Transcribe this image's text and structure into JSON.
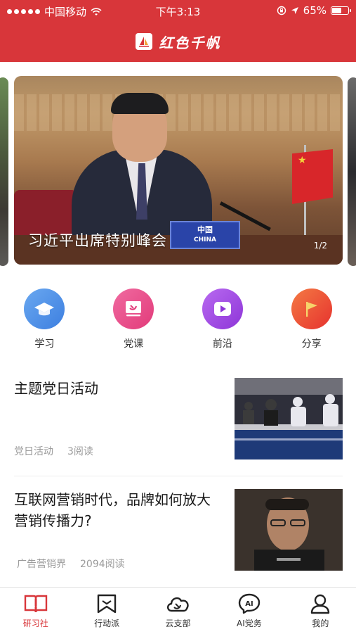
{
  "status_bar": {
    "carrier": "中国移动",
    "time": "下午3:13",
    "battery_percent": "65%",
    "battery_level": 0.65
  },
  "header": {
    "app_title": "红色千帆",
    "brand_color": "#d8363a"
  },
  "carousel": {
    "caption": "习近平出席特别峰会",
    "counter": "1/2",
    "nameplate": "中国",
    "nameplate_en": "CHINA"
  },
  "quick_actions": [
    {
      "label": "学习",
      "icon": "graduation-cap-icon",
      "color": "#4a90e2"
    },
    {
      "label": "党课",
      "icon": "party-emblem-icon",
      "color": "#ea4c89"
    },
    {
      "label": "前沿",
      "icon": "play-icon",
      "color": "#a148e0"
    },
    {
      "label": "分享",
      "icon": "flag-icon",
      "color": "#f0512e"
    }
  ],
  "articles": [
    {
      "title": "主题党日活动",
      "source": "党日活动",
      "reads": "3阅读"
    },
    {
      "title": "互联网营销时代，品牌如何放大营销传播力?",
      "source": "广告营销界",
      "reads": "2094阅读"
    }
  ],
  "tabs": [
    {
      "label": "研习社",
      "icon": "book-icon",
      "active": true
    },
    {
      "label": "行动派",
      "icon": "banner-icon",
      "active": false
    },
    {
      "label": "云支部",
      "icon": "cloud-icon",
      "active": false
    },
    {
      "label": "AI党务",
      "icon": "ai-bubble-icon",
      "active": false
    },
    {
      "label": "我的",
      "icon": "user-icon",
      "active": false
    }
  ]
}
